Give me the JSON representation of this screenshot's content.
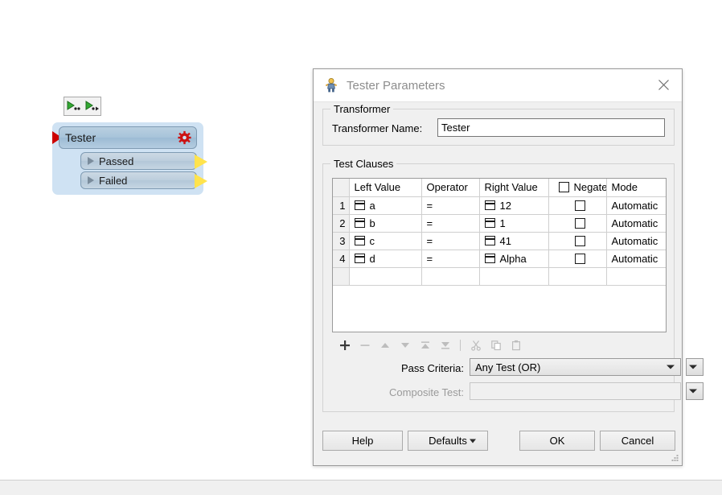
{
  "canvas": {
    "node": {
      "title": "Tester",
      "gear_icon": "gear-icon",
      "input_port_icon": "input-arrow-icon",
      "ports": [
        {
          "label": "Passed"
        },
        {
          "label": "Failed"
        }
      ],
      "toolbar": {
        "run_to_here_icon": "run-to-here-icon",
        "run_from_here_icon": "run-from-here-icon"
      },
      "colors": {
        "body": "#cfe2f3",
        "header": "#a8c4da",
        "input_arrow": "#cc0000",
        "gear": "#cc1111",
        "output_arrow": "#ffe34d"
      }
    }
  },
  "dialog": {
    "title": "Tester Parameters",
    "title_icon": "transformer-figure-icon",
    "close_icon": "close-icon",
    "transformer": {
      "group_title": "Transformer",
      "name_label": "Transformer Name:",
      "name_value": "Tester",
      "name_placeholder": ""
    },
    "test_clauses": {
      "group_title": "Test Clauses",
      "columns": [
        "Left Value",
        "Operator",
        "Right Value",
        "Negate",
        "Mode"
      ],
      "negate_header_checkbox": false,
      "rows": [
        {
          "num": "1",
          "left": "a",
          "operator": "=",
          "right": "12",
          "negate": false,
          "mode": "Automatic"
        },
        {
          "num": "2",
          "left": "b",
          "operator": "=",
          "right": "1",
          "negate": false,
          "mode": "Automatic"
        },
        {
          "num": "3",
          "left": "c",
          "operator": "=",
          "right": "41",
          "negate": false,
          "mode": "Automatic"
        },
        {
          "num": "4",
          "left": "d",
          "operator": "=",
          "right": "Alpha",
          "negate": false,
          "mode": "Automatic"
        }
      ],
      "toolbar": [
        {
          "name": "add-row-button",
          "icon": "plus-icon",
          "enabled": true
        },
        {
          "name": "remove-row-button",
          "icon": "minus-icon",
          "enabled": false
        },
        {
          "name": "move-row-up-button",
          "icon": "arrow-up-icon",
          "enabled": false
        },
        {
          "name": "move-row-down-button",
          "icon": "arrow-down-icon",
          "enabled": false
        },
        {
          "name": "move-row-to-top-button",
          "icon": "move-to-top-icon",
          "enabled": false
        },
        {
          "name": "move-row-to-bottom-button",
          "icon": "move-to-bottom-icon",
          "enabled": false
        },
        {
          "name": "cut-button",
          "icon": "scissors-icon",
          "enabled": false
        },
        {
          "name": "copy-button",
          "icon": "copy-icon",
          "enabled": false
        },
        {
          "name": "paste-button",
          "icon": "paste-icon",
          "enabled": false
        }
      ]
    },
    "pass_criteria": {
      "label": "Pass Criteria:",
      "value": "Any Test (OR)",
      "menu_icon": "chevron-down-icon"
    },
    "composite_test": {
      "label": "Composite Test:",
      "value": "",
      "placeholder": "",
      "disabled": true,
      "menu_icon": "chevron-down-icon"
    },
    "footer": {
      "help_label": "Help",
      "defaults_label": "Defaults",
      "ok_label": "OK",
      "cancel_label": "Cancel",
      "resize_grip_icon": "resize-grip-icon"
    }
  }
}
